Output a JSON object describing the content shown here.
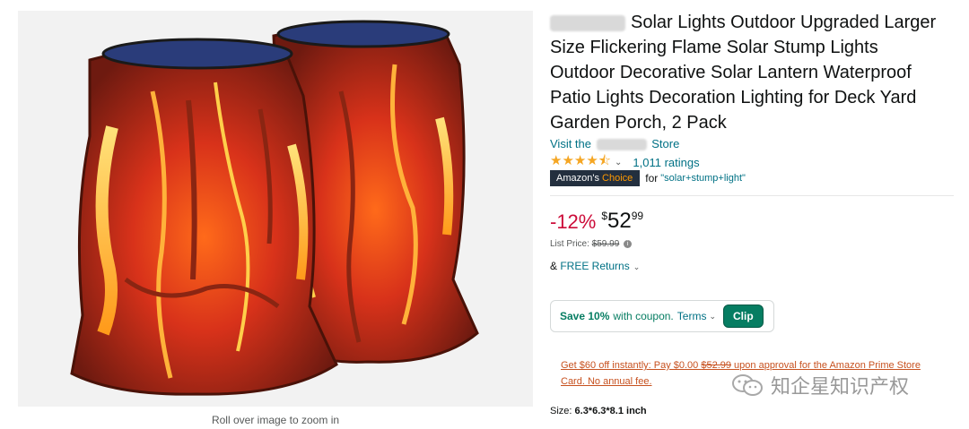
{
  "gallery": {
    "zoom_hint": "Roll over image to zoom in"
  },
  "product": {
    "title": "Solar Lights Outdoor Upgraded Larger Size Flickering Flame Solar Stump Lights Outdoor Decorative Solar Lantern Waterproof Patio Lights Decoration Lighting for Deck Yard Garden Porch, 2 Pack",
    "store_prefix": "Visit the",
    "store_suffix": "Store",
    "rating_stars": "★★★★⯪",
    "rating_value": 4.5,
    "rating_count": "1,011 ratings",
    "badge_main": "Amazon's ",
    "badge_accent": "Choice",
    "badge_for": "for",
    "badge_keyword": "\"solar+stump+light\""
  },
  "pricing": {
    "discount": "-12%",
    "currency": "$",
    "whole": "52",
    "fraction": "99",
    "list_label": "List Price: ",
    "list_price": "$59.99",
    "returns_prefix": "& ",
    "returns_link": "FREE Returns"
  },
  "coupon": {
    "save": "Save 10%",
    "with": "with coupon.",
    "terms": "Terms",
    "clip": "Clip"
  },
  "promo": {
    "part1": "Get $60 off instantly: Pay $0.00 ",
    "struck": "$52.99",
    "part2": " upon approval for the Amazon Prime Store Card. No annual fee."
  },
  "size": {
    "label": "Size: ",
    "value": "6.3*6.3*8.1 inch"
  },
  "watermark": {
    "text": "知企星知识产权"
  },
  "colors": {
    "link": "#007185",
    "price_red": "#cc0c39",
    "coupon_green": "#067d62",
    "badge_bg": "#232f3e",
    "badge_accent": "#ff9900",
    "promo": "#c7511f"
  }
}
